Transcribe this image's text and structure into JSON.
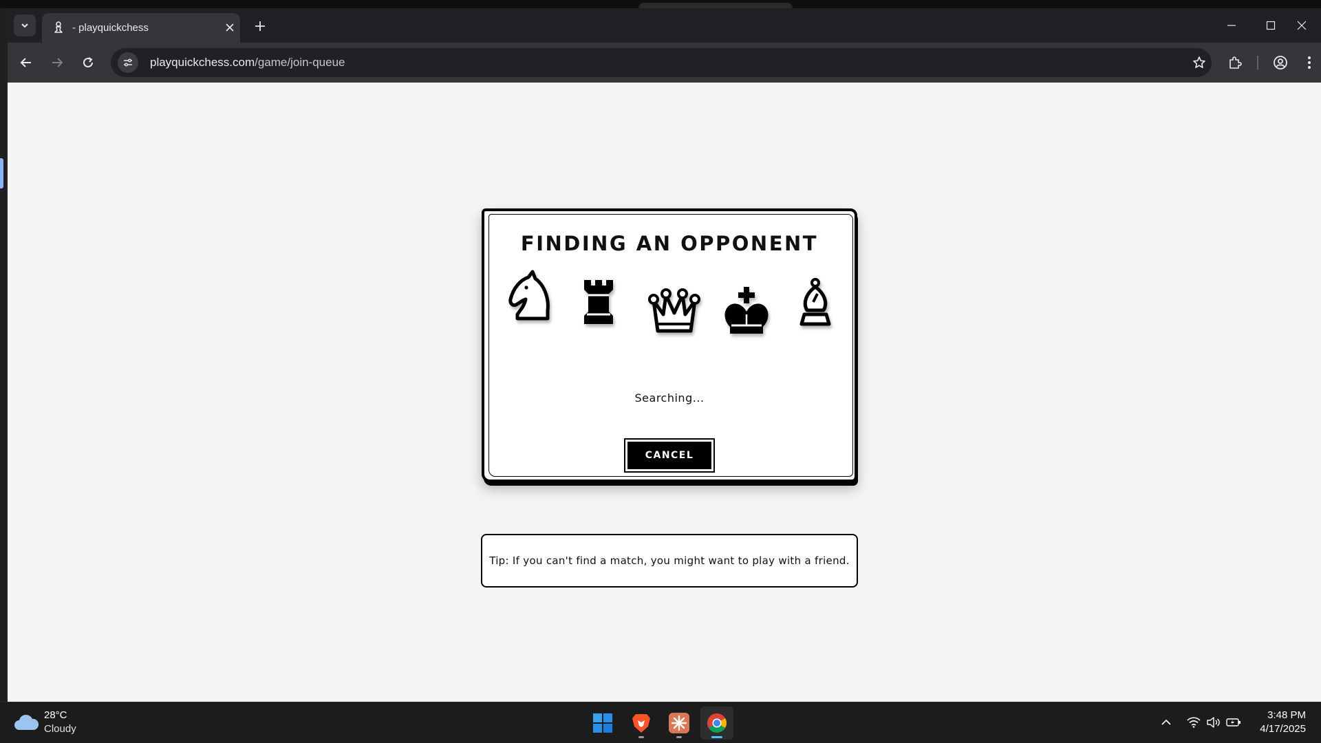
{
  "browser": {
    "tab_title": "- playquickchess",
    "url_domain": "playquickchess.com",
    "url_path": "/game/join-queue"
  },
  "page": {
    "heading": "FINDING AN OPPONENT",
    "pieces": [
      "knight-icon",
      "rook-icon",
      "queen-icon",
      "king-icon",
      "bishop-icon"
    ],
    "status_text": "Searching...",
    "cancel_label": "CANCEL",
    "tip_text": "Tip: If you can't find a match, you might want to play with a friend."
  },
  "taskbar": {
    "weather_temp": "28°C",
    "weather_desc": "Cloudy",
    "apps": [
      "start-icon",
      "brave-icon",
      "claude-icon",
      "chrome-icon"
    ],
    "time": "3:48 PM",
    "date": "4/17/2025"
  },
  "colors": {
    "page_bg": "#f4f4f4",
    "chrome_dark": "#202124",
    "chrome_toolbar": "#35363a",
    "accent": "#4cc2ff"
  }
}
